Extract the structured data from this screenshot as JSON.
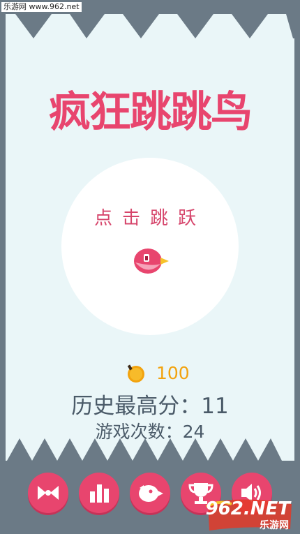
{
  "watermark_top": "乐游网 www.962.net",
  "title": "疯狂跳跳鸟",
  "prompt": "点击跳跃",
  "coins": "100",
  "best_score": "历史最高分：11",
  "play_count": "游戏次数：24",
  "watermark_brand": "962.NET",
  "watermark_site": "乐游网",
  "colors": {
    "background": "#eaf6f8",
    "frame": "#6b7a86",
    "accent": "#e8456e",
    "coin": "#f2a30f",
    "text": "#4a5a68"
  },
  "buttons": [
    {
      "name": "fish-bones-button",
      "icon": "fish-bones-icon"
    },
    {
      "name": "leaderboard-button",
      "icon": "bar-chart-icon"
    },
    {
      "name": "bird-skins-button",
      "icon": "bird-icon"
    },
    {
      "name": "achievements-button",
      "icon": "trophy-icon"
    },
    {
      "name": "sound-button",
      "icon": "speaker-icon"
    }
  ]
}
